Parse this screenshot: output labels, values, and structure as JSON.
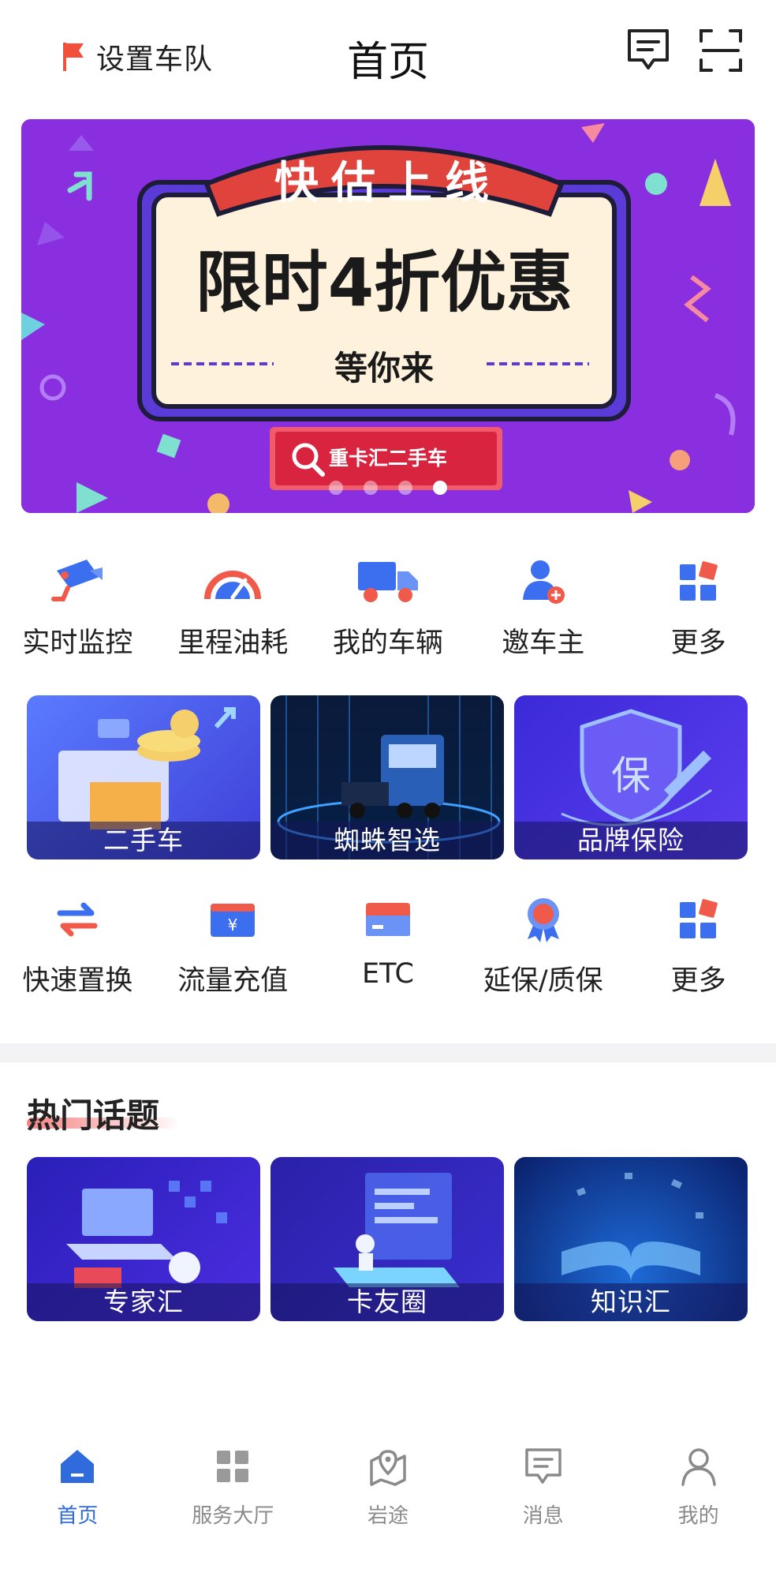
{
  "header": {
    "fleet_label": "设置车队",
    "title": "首页",
    "message_icon": "message-icon",
    "scan_icon": "scan-icon"
  },
  "banner": {
    "ribbon_text": "快估上线",
    "headline": "限时4折优惠",
    "subline": "等你来",
    "search_label": "重卡汇二手车",
    "slide_count": 4,
    "active_slide": 4
  },
  "quick_row_1": [
    {
      "label": "实时监控",
      "icon": "camera-icon"
    },
    {
      "label": "里程油耗",
      "icon": "gauge-icon"
    },
    {
      "label": "我的车辆",
      "icon": "truck-icon"
    },
    {
      "label": "邀车主",
      "icon": "add-user-icon"
    },
    {
      "label": "更多",
      "icon": "grid-icon"
    }
  ],
  "feature_tiles": [
    {
      "label": "二手车"
    },
    {
      "label": "蜘蛛智选"
    },
    {
      "label": "品牌保险",
      "badge": "保"
    }
  ],
  "quick_row_2": [
    {
      "label": "快速置换",
      "icon": "swap-icon"
    },
    {
      "label": "流量充值",
      "icon": "wallet-icon"
    },
    {
      "label": "ETC",
      "icon": "card-icon"
    },
    {
      "label": "延保/质保",
      "icon": "award-icon"
    },
    {
      "label": "更多",
      "icon": "grid-icon"
    }
  ],
  "hot_topics": {
    "title": "热门话题",
    "tiles": [
      {
        "label": "专家汇"
      },
      {
        "label": "卡友圈"
      },
      {
        "label": "知识汇"
      }
    ]
  },
  "bottom_nav": [
    {
      "label": "首页",
      "icon": "home-icon",
      "active": true
    },
    {
      "label": "服务大厅",
      "icon": "grid-icon",
      "active": false
    },
    {
      "label": "岩途",
      "icon": "map-pin-icon",
      "active": false
    },
    {
      "label": "消息",
      "icon": "message-icon",
      "active": false
    },
    {
      "label": "我的",
      "icon": "user-icon",
      "active": false
    }
  ],
  "colors": {
    "accent_blue": "#2f6bdc",
    "accent_red": "#f05a5a",
    "banner_purple": "#8a2fe0"
  }
}
